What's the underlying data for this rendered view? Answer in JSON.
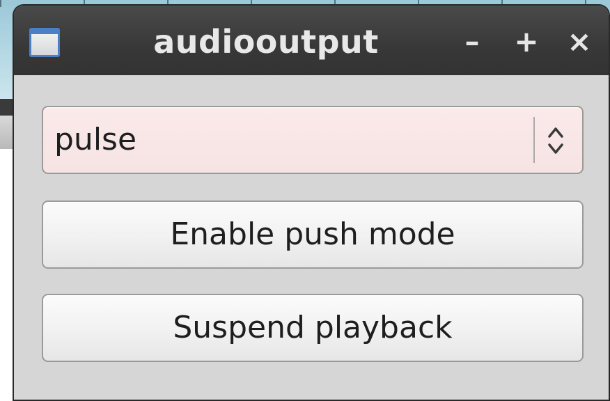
{
  "window": {
    "title": "audiooutput",
    "controls": {
      "minimize": "–",
      "maximize": "+",
      "close": "×"
    },
    "icon": "window-app-icon"
  },
  "device_select": {
    "selected": "pulse",
    "icon": "updown-arrows-icon",
    "background_color": "#f6e3e3"
  },
  "buttons": {
    "push_mode": "Enable push mode",
    "suspend": "Suspend playback"
  },
  "colors": {
    "titlebar": "#383838",
    "client_bg": "#d6d6d6"
  }
}
